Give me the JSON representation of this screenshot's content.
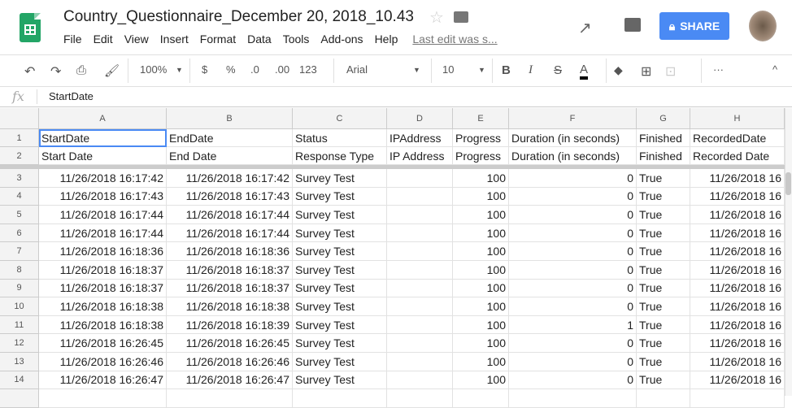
{
  "doc": {
    "title": "Country_Questionnaire_December 20, 2018_10.43",
    "last_edit": "Last edit was s..."
  },
  "menu": [
    "File",
    "Edit",
    "View",
    "Insert",
    "Format",
    "Data",
    "Tools",
    "Add-ons",
    "Help"
  ],
  "share_label": "SHARE",
  "toolbar": {
    "zoom": "100%",
    "currency": "$",
    "percent": "%",
    "dec_less": ".0",
    "dec_more": ".00",
    "format": "123",
    "font": "Arial",
    "size": "10",
    "bold": "B",
    "italic": "I",
    "strike": "S",
    "textcolor": "A",
    "more": "···",
    "collapse": "^"
  },
  "formula": {
    "label": "fx",
    "value": "StartDate"
  },
  "columns": [
    "A",
    "B",
    "C",
    "D",
    "E",
    "F",
    "G",
    "H"
  ],
  "rows": [
    {
      "n": "1",
      "c": [
        "StartDate",
        "EndDate",
        "Status",
        "IPAddress",
        "Progress",
        "Duration (in seconds)",
        "Finished",
        "RecordedDate"
      ]
    },
    {
      "n": "2",
      "c": [
        "Start Date",
        "End Date",
        "Response Type",
        "IP Address",
        "Progress",
        "Duration (in seconds)",
        "Finished",
        "Recorded Date"
      ]
    },
    {
      "n": "3",
      "c": [
        "11/26/2018 16:17:42",
        "11/26/2018 16:17:42",
        "Survey Test",
        "",
        "100",
        "0",
        "True",
        "11/26/2018 16"
      ]
    },
    {
      "n": "4",
      "c": [
        "11/26/2018 16:17:43",
        "11/26/2018 16:17:43",
        "Survey Test",
        "",
        "100",
        "0",
        "True",
        "11/26/2018 16"
      ]
    },
    {
      "n": "5",
      "c": [
        "11/26/2018 16:17:44",
        "11/26/2018 16:17:44",
        "Survey Test",
        "",
        "100",
        "0",
        "True",
        "11/26/2018 16"
      ]
    },
    {
      "n": "6",
      "c": [
        "11/26/2018 16:17:44",
        "11/26/2018 16:17:44",
        "Survey Test",
        "",
        "100",
        "0",
        "True",
        "11/26/2018 16"
      ]
    },
    {
      "n": "7",
      "c": [
        "11/26/2018 16:18:36",
        "11/26/2018 16:18:36",
        "Survey Test",
        "",
        "100",
        "0",
        "True",
        "11/26/2018 16"
      ]
    },
    {
      "n": "8",
      "c": [
        "11/26/2018 16:18:37",
        "11/26/2018 16:18:37",
        "Survey Test",
        "",
        "100",
        "0",
        "True",
        "11/26/2018 16"
      ]
    },
    {
      "n": "9",
      "c": [
        "11/26/2018 16:18:37",
        "11/26/2018 16:18:37",
        "Survey Test",
        "",
        "100",
        "0",
        "True",
        "11/26/2018 16"
      ]
    },
    {
      "n": "10",
      "c": [
        "11/26/2018 16:18:38",
        "11/26/2018 16:18:38",
        "Survey Test",
        "",
        "100",
        "0",
        "True",
        "11/26/2018 16"
      ]
    },
    {
      "n": "11",
      "c": [
        "11/26/2018 16:18:38",
        "11/26/2018 16:18:39",
        "Survey Test",
        "",
        "100",
        "1",
        "True",
        "11/26/2018 16"
      ]
    },
    {
      "n": "12",
      "c": [
        "11/26/2018 16:26:45",
        "11/26/2018 16:26:45",
        "Survey Test",
        "",
        "100",
        "0",
        "True",
        "11/26/2018 16"
      ]
    },
    {
      "n": "13",
      "c": [
        "11/26/2018 16:26:46",
        "11/26/2018 16:26:46",
        "Survey Test",
        "",
        "100",
        "0",
        "True",
        "11/26/2018 16"
      ]
    },
    {
      "n": "14",
      "c": [
        "11/26/2018 16:26:47",
        "11/26/2018 16:26:47",
        "Survey Test",
        "",
        "100",
        "0",
        "True",
        "11/26/2018 16"
      ]
    }
  ]
}
